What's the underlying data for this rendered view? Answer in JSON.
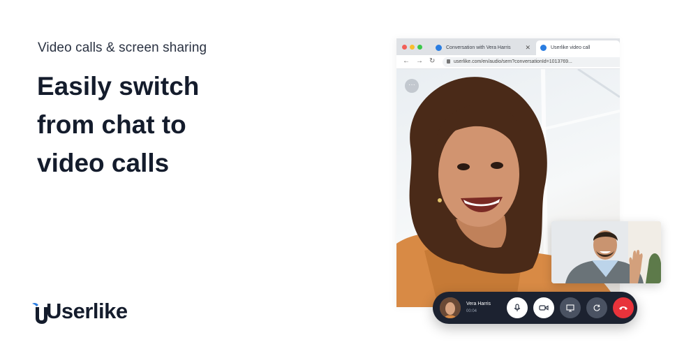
{
  "hero": {
    "eyebrow": "Video calls & screen sharing",
    "headline_lines": [
      "Easily switch",
      "from chat to",
      "video calls"
    ]
  },
  "brand": {
    "logo_text": "Userlike",
    "accent": "#2a7de1"
  },
  "browser": {
    "tabs": [
      {
        "label": "Conversation with Vera Harris",
        "icon": "userlike-favicon",
        "close": "✕"
      },
      {
        "label": "Userlike video call",
        "icon": "userlike-favicon",
        "active": true
      }
    ],
    "url": "userlike.com/en/audio/sem?conversationId=1013769...",
    "nav_icons": [
      "back-arrow-icon",
      "forward-arrow-icon",
      "reload-icon"
    ],
    "more_button": "···"
  },
  "call": {
    "agent_name": "Vera Harris",
    "elapsed": "00:04",
    "controls": [
      {
        "name": "microphone",
        "style": "light"
      },
      {
        "name": "camera",
        "style": "light"
      },
      {
        "name": "screen-share",
        "style": "dark"
      },
      {
        "name": "switch-camera",
        "style": "dark"
      },
      {
        "name": "hang-up",
        "style": "red"
      }
    ],
    "colors": {
      "bar": "#1c2230",
      "hangup": "#e8333b"
    }
  }
}
